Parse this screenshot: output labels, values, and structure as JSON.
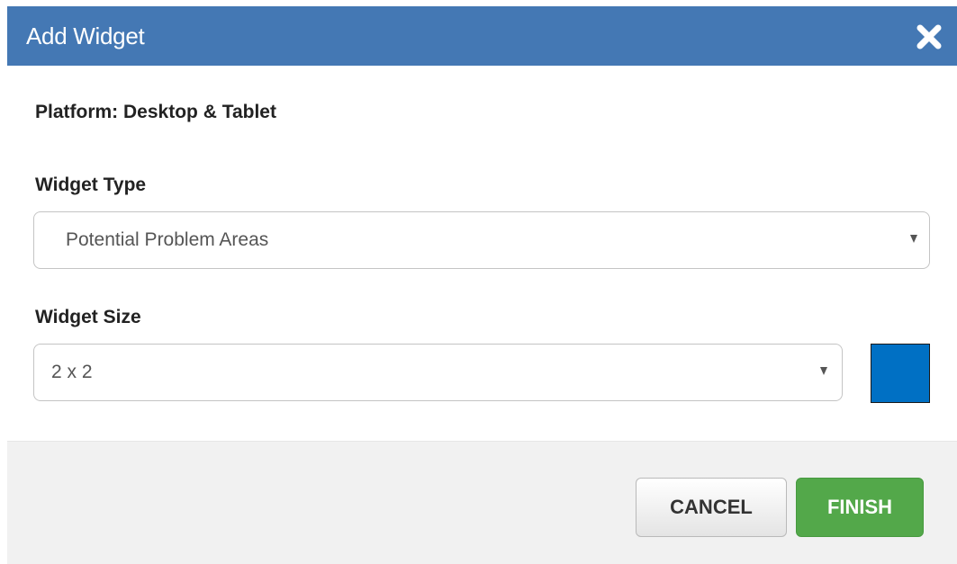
{
  "dialog": {
    "title": "Add Widget",
    "close_icon": "close-icon"
  },
  "platform": {
    "text": "Platform: Desktop & Tablet"
  },
  "widget_type": {
    "label": "Widget Type",
    "selected": "Potential Problem Areas"
  },
  "widget_size": {
    "label": "Widget Size",
    "selected": "2 x 2",
    "color": "#0070c4"
  },
  "buttons": {
    "cancel": "CANCEL",
    "finish": "FINISH"
  },
  "colors": {
    "header": "#4478b4",
    "finish": "#53a84a",
    "footer": "#f1f1f1"
  }
}
